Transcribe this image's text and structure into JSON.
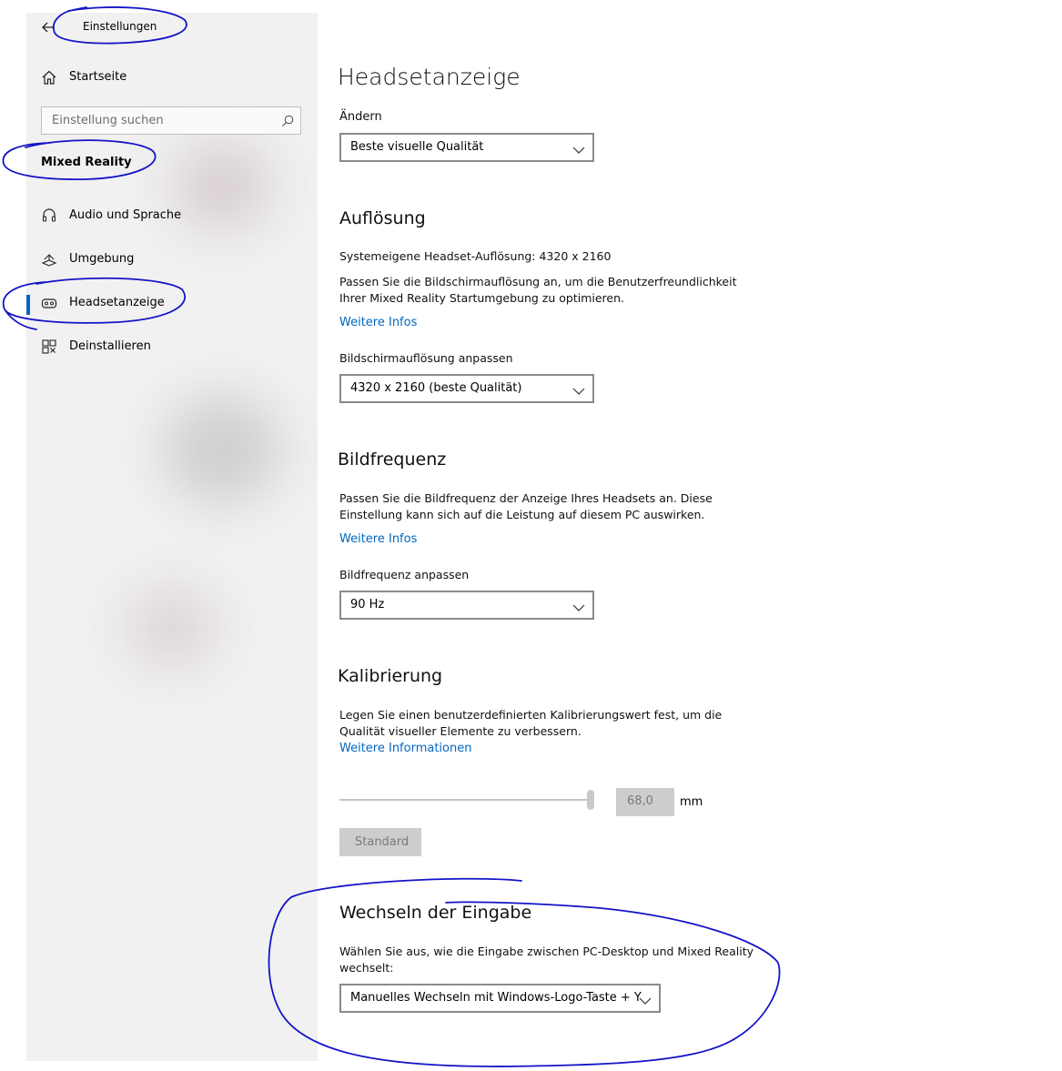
{
  "window": {
    "title": "Einstellungen"
  },
  "sidebar": {
    "home_label": "Startseite",
    "search_placeholder": "Einstellung suchen",
    "section_title": "Mixed Reality",
    "items": [
      {
        "label": "Audio und Sprache",
        "icon": "headset-icon"
      },
      {
        "label": "Umgebung",
        "icon": "environment-icon"
      },
      {
        "label": "Headsetanzeige",
        "icon": "headset-display-icon",
        "selected": true
      },
      {
        "label": "Deinstallieren",
        "icon": "uninstall-icon"
      }
    ]
  },
  "main": {
    "page_title": "Headsetanzeige",
    "change_label": "Ändern",
    "change_value": "Beste visuelle Qualität",
    "resolution": {
      "heading": "Auflösung",
      "native": "Systemeigene Headset-Auflösung: 4320 x 2160",
      "desc_line1": "Passen Sie die Bildschirmauflösung an, um die Benutzerfreundlichkeit",
      "desc_line2": "Ihrer Mixed Reality Startumgebung zu optimieren.",
      "link": "Weitere Infos",
      "adjust_label": "Bildschirmauflösung anpassen",
      "adjust_value": "4320 x 2160 (beste Qualität)"
    },
    "framerate": {
      "heading": "Bildfrequenz",
      "desc_line1": "Passen Sie die Bildfrequenz der Anzeige Ihres Headsets an. Diese",
      "desc_line2": "Einstellung kann sich auf die Leistung auf diesem PC auswirken.",
      "link": "Weitere Infos",
      "adjust_label": "Bildfrequenz anpassen",
      "adjust_value": "90 Hz"
    },
    "calibration": {
      "heading": "Kalibrierung",
      "desc_line1": "Legen Sie einen benutzerdefinierten Kalibrierungswert fest, um die",
      "desc_line2": "Qualität visueller Elemente zu verbessern.",
      "link": "Weitere Informationen",
      "value": "68,0",
      "unit": "mm",
      "default_button": "Standard"
    },
    "input_switch": {
      "heading": "Wechseln der Eingabe",
      "desc_line1": "Wählen Sie aus, wie die Eingabe zwischen PC-Desktop und Mixed Reality",
      "desc_line2": "wechselt:",
      "value": "Manuelles Wechseln mit Windows-Logo-Taste + Y"
    }
  },
  "colors": {
    "accent": "#0067c0",
    "annotation": "#1414c8",
    "sidebar_bg": "#f1f1f1"
  }
}
